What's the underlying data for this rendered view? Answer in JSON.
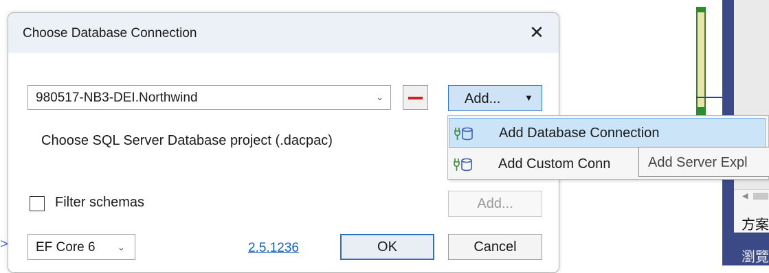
{
  "dialog": {
    "title": "Choose Database Connection",
    "close_glyph": "✕",
    "connection_select": {
      "value": "980517-NB3-DEI.Northwind",
      "chevron": "⌄"
    },
    "remove_button_icon": "minus-icon",
    "add_split_button": {
      "label": "Add...",
      "arrow": "▼"
    },
    "dacpac_label": "Choose SQL Server Database project (.dacpac)",
    "filter_schemas": {
      "label": "Filter schemas",
      "checked": false
    },
    "schemas_add_button": "Add...",
    "ef_select": {
      "value": "EF Core 6",
      "chevron": "⌄"
    },
    "version_link": "2.5.1236",
    "ok_button": "OK",
    "cancel_button": "Cancel"
  },
  "add_menu": {
    "items": [
      {
        "label": "Add Database Connection",
        "icon": "plug-db-icon",
        "highlighted": true
      },
      {
        "label": "Add Custom Conn",
        "icon": "plug-db-icon",
        "highlighted": false
      }
    ]
  },
  "tooltip": {
    "text": "Add Server Expl"
  },
  "background": {
    "cjk_text_1": "方案",
    "cjk_text_2": "瀏覽",
    "scroll_left_glyph": "◀",
    "left_edge_glyph": ">"
  },
  "colors": {
    "accent": "#3377c7",
    "remove_red": "#d21f2a",
    "menu_highlight": "#cce4f7",
    "ide_panel": "#3b4a86",
    "icon_green": "#3a8a3a"
  }
}
